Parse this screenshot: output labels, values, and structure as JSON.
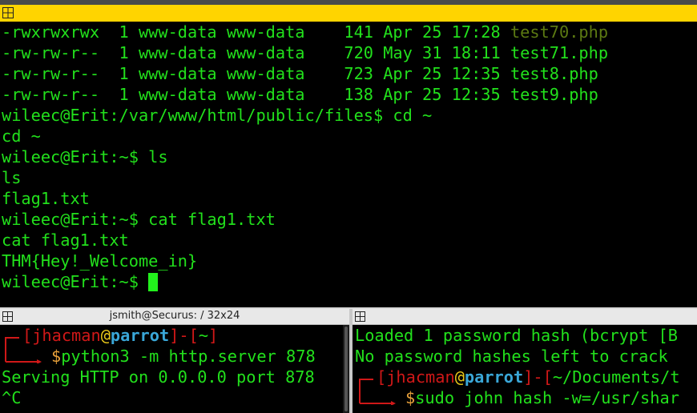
{
  "top_terminal": {
    "lines": [
      {
        "pre": "-rwxrwxrwx  1 www-data www-data    141 Apr 25 17:28 ",
        "file": "test70.php",
        "file_style": "olive"
      },
      {
        "pre": "-rw-rw-r--  1 www-data www-data    720 May 31 18:11 ",
        "file": "test71.php",
        "file_style": "green"
      },
      {
        "pre": "-rw-rw-r--  1 www-data www-data    723 Apr 25 12:35 ",
        "file": "test8.php",
        "file_style": "green"
      },
      {
        "pre": "-rw-rw-r--  1 www-data www-data    138 Apr 25 12:35 ",
        "file": "test9.php",
        "file_style": "green"
      }
    ],
    "session": [
      "wileec@Erit:/var/www/html/public/files$ cd ~",
      "cd ~",
      "wileec@Erit:~$ ls",
      "ls",
      "flag1.txt",
      "wileec@Erit:~$ cat flag1.txt",
      "cat flag1.txt",
      "THM{Hey!_Welcome_in}",
      "wileec@Erit:~$ "
    ]
  },
  "left_pane": {
    "title": "jsmith@Securus: / 32x24",
    "prompt_user": "jhacman",
    "prompt_at": "@",
    "prompt_host": "parrot",
    "prompt_dir": "~",
    "command": "python3 -m http.server 878",
    "output1": "Serving HTTP on 0.0.0.0 port 878",
    "output2": "^C"
  },
  "right_pane": {
    "title": "",
    "output1": "Loaded 1 password hash (bcrypt [B",
    "output2": "No password hashes left to crack",
    "prompt_user": "jhacman",
    "prompt_at": "@",
    "prompt_host": "parrot",
    "prompt_dir": "~/Documents/t",
    "command": "sudo john hash -w=/usr/shar"
  },
  "colors": {
    "terminal_green": "#22e01c",
    "title_yellow": "#ffd400",
    "prompt_red": "#d01818",
    "host_cyan": "#3aa7d8"
  },
  "icons": [
    "window-menu-icon",
    "pane-menu-icon"
  ]
}
